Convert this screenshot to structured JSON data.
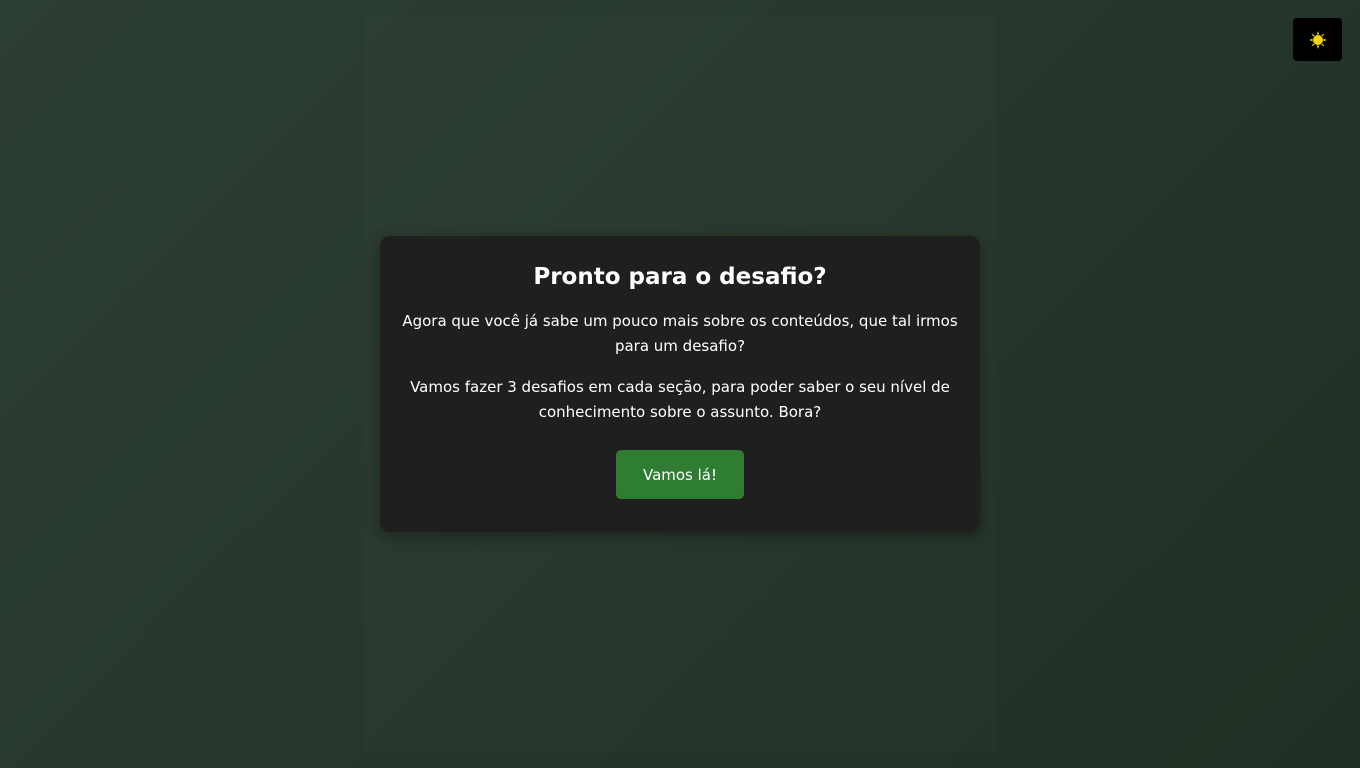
{
  "theme_toggle": {
    "icon": "sun-icon",
    "icon_color": "#f4d60c"
  },
  "modal": {
    "title": "Pronto para o desafio?",
    "paragraph_1": "Agora que você já sabe um pouco mais sobre os conteúdos, que tal irmos para um desafio?",
    "paragraph_2": "Vamos fazer 3 desafios em cada seção, para poder saber o seu nível de conhecimento sobre o assunto. Bora?",
    "button_label": "Vamos lá!"
  },
  "colors": {
    "background": "#27372c",
    "modal_background": "#1f1f1f",
    "button_background": "#2e7d32",
    "toggle_background": "#000000"
  }
}
